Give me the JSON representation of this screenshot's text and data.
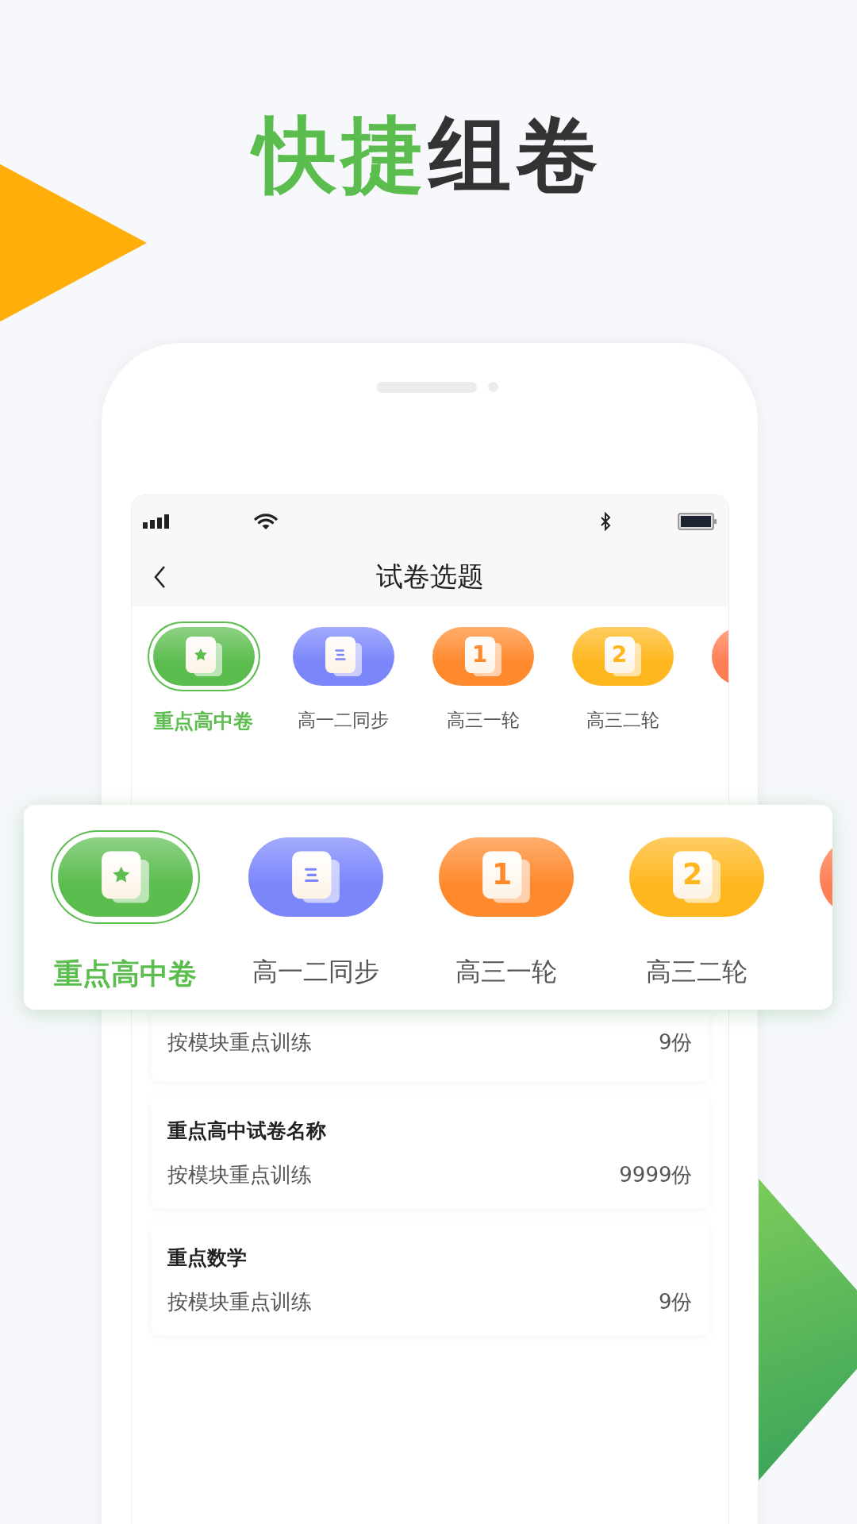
{
  "headline": {
    "highlight": "快捷",
    "rest": "组卷"
  },
  "screen": {
    "nav": {
      "title": "试卷选题"
    },
    "categories": [
      {
        "kind": "star",
        "label": "重点高中卷",
        "color": "#5cbd4f",
        "selected": true
      },
      {
        "kind": "list",
        "label": "高一二同步",
        "color": "#7b86fb",
        "selected": false
      },
      {
        "kind": "number",
        "number": "1",
        "label": "高三一轮",
        "color": "#ff8a2e",
        "selected": false
      },
      {
        "kind": "number",
        "number": "2",
        "label": "高三二轮",
        "color": "#ffb71f",
        "selected": false
      },
      {
        "kind": "blank",
        "color": "#ff7f55",
        "selected": false
      }
    ],
    "papers": [
      {
        "subtitle": "按模块重点训练",
        "count": "9份"
      },
      {
        "title": "重点高中试卷名称",
        "subtitle": "按模块重点训练",
        "count": "9999份"
      },
      {
        "title": "重点数学",
        "subtitle": "按模块重点训练",
        "count": "9份"
      }
    ]
  },
  "zoom_card": {
    "categories": [
      {
        "kind": "star",
        "label": "重点高中卷",
        "color": "#5cbd4f",
        "selected": true
      },
      {
        "kind": "list",
        "label": "高一二同步",
        "color": "#7b86fb",
        "selected": false
      },
      {
        "kind": "number",
        "number": "1",
        "label": "高三一轮",
        "color": "#ff8a2e",
        "selected": false
      },
      {
        "kind": "number",
        "number": "2",
        "label": "高三二轮",
        "color": "#ffb71f",
        "selected": false
      },
      {
        "kind": "blank",
        "color": "#ff7f55",
        "selected": false
      }
    ]
  }
}
